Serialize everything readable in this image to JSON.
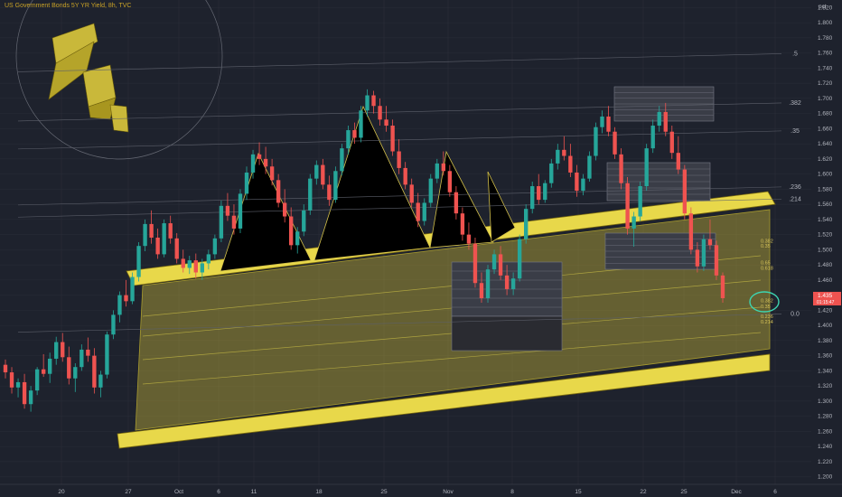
{
  "symbol": {
    "title": "US Government Bonds 5Y YR Yield, 8h, TVC"
  },
  "colors": {
    "background": "#1e222d",
    "grid": "#2a2e39",
    "up": "#26a69a",
    "down": "#ef5350",
    "gold": "#c9b83a",
    "gold_light": "#e8d84a",
    "gold_dark": "#8a7a10",
    "last_price_bg": "#ef5350",
    "circle": "#3dd4b0"
  },
  "chart_data": {
    "type": "candlestick",
    "y_unit_label": "pct",
    "ylim": [
      1.19,
      1.83
    ],
    "y_ticks": [
      "1.200",
      "1.220",
      "1.240",
      "1.260",
      "1.280",
      "1.300",
      "1.320",
      "1.340",
      "1.360",
      "1.380",
      "1.400",
      "1.420",
      "1.440",
      "1.460",
      "1.480",
      "1.500",
      "1.520",
      "1.540",
      "1.560",
      "1.580",
      "1.600",
      "1.620",
      "1.640",
      "1.660",
      "1.680",
      "1.700",
      "1.720",
      "1.740",
      "1.760",
      "1.780",
      "1.800",
      "1.820"
    ],
    "x_ticks": [
      "20",
      "27",
      "Oct",
      "6",
      "11",
      "18",
      "25",
      "Nov",
      "8",
      "15",
      "22",
      "25",
      "Dec",
      "6"
    ],
    "fib_levels": [
      {
        "label": ".5",
        "value": 1.759
      },
      {
        "label": ".382",
        "value": 1.694
      },
      {
        "label": ".35",
        "value": 1.657
      },
      {
        "label": ".236",
        "value": 1.583
      },
      {
        "label": ".214",
        "value": 1.567
      },
      {
        "label": "0.0",
        "value": 1.415
      }
    ],
    "small_labels": [
      {
        "label": "0.382",
        "value": 1.512
      },
      {
        "label": "0.35",
        "value": 1.505
      },
      {
        "label": "0.65",
        "value": 1.483
      },
      {
        "label": "0.618",
        "value": 1.476
      },
      {
        "label": "0.382",
        "value": 1.433
      },
      {
        "label": "0.35",
        "value": 1.425
      },
      {
        "label": "0.236",
        "value": 1.412
      },
      {
        "label": "0.214",
        "value": 1.405
      }
    ],
    "last_price": {
      "value": 1.436,
      "label": "1.435",
      "sub": "01:15:47"
    },
    "candles": [
      [
        1.348,
        1.355,
        1.33,
        1.338
      ],
      [
        1.338,
        1.345,
        1.31,
        1.318
      ],
      [
        1.318,
        1.33,
        1.305,
        1.325
      ],
      [
        1.325,
        1.336,
        1.29,
        1.296
      ],
      [
        1.296,
        1.32,
        1.286,
        1.314
      ],
      [
        1.314,
        1.345,
        1.308,
        1.342
      ],
      [
        1.342,
        1.362,
        1.332,
        1.336
      ],
      [
        1.336,
        1.364,
        1.324,
        1.356
      ],
      [
        1.356,
        1.385,
        1.348,
        1.378
      ],
      [
        1.378,
        1.39,
        1.352,
        1.358
      ],
      [
        1.358,
        1.372,
        1.322,
        1.33
      ],
      [
        1.33,
        1.35,
        1.312,
        1.345
      ],
      [
        1.345,
        1.375,
        1.34,
        1.368
      ],
      [
        1.368,
        1.384,
        1.352,
        1.36
      ],
      [
        1.36,
        1.37,
        1.31,
        1.318
      ],
      [
        1.318,
        1.34,
        1.305,
        1.335
      ],
      [
        1.335,
        1.392,
        1.33,
        1.388
      ],
      [
        1.388,
        1.42,
        1.382,
        1.414
      ],
      [
        1.414,
        1.445,
        1.404,
        1.44
      ],
      [
        1.44,
        1.46,
        1.425,
        1.432
      ],
      [
        1.432,
        1.47,
        1.428,
        1.464
      ],
      [
        1.464,
        1.51,
        1.458,
        1.505
      ],
      [
        1.505,
        1.54,
        1.498,
        1.534
      ],
      [
        1.534,
        1.552,
        1.508,
        1.516
      ],
      [
        1.516,
        1.528,
        1.488,
        1.494
      ],
      [
        1.494,
        1.54,
        1.49,
        1.535
      ],
      [
        1.535,
        1.545,
        1.508,
        1.515
      ],
      [
        1.515,
        1.522,
        1.482,
        1.488
      ],
      [
        1.488,
        1.5,
        1.47,
        1.476
      ],
      [
        1.476,
        1.492,
        1.468,
        1.486
      ],
      [
        1.486,
        1.495,
        1.462,
        1.47
      ],
      [
        1.47,
        1.488,
        1.46,
        1.482
      ],
      [
        1.482,
        1.5,
        1.474,
        1.494
      ],
      [
        1.494,
        1.52,
        1.488,
        1.515
      ],
      [
        1.515,
        1.565,
        1.51,
        1.558
      ],
      [
        1.558,
        1.575,
        1.538,
        1.545
      ],
      [
        1.545,
        1.56,
        1.52,
        1.528
      ],
      [
        1.528,
        1.58,
        1.522,
        1.574
      ],
      [
        1.574,
        1.61,
        1.566,
        1.602
      ],
      [
        1.602,
        1.632,
        1.594,
        1.626
      ],
      [
        1.626,
        1.642,
        1.612,
        1.62
      ],
      [
        1.62,
        1.636,
        1.6,
        1.61
      ],
      [
        1.61,
        1.62,
        1.585,
        1.592
      ],
      [
        1.592,
        1.6,
        1.556,
        1.562
      ],
      [
        1.562,
        1.58,
        1.536,
        1.544
      ],
      [
        1.544,
        1.556,
        1.5,
        1.506
      ],
      [
        1.506,
        1.53,
        1.495,
        1.524
      ],
      [
        1.524,
        1.56,
        1.518,
        1.552
      ],
      [
        1.552,
        1.6,
        1.546,
        1.594
      ],
      [
        1.594,
        1.618,
        1.586,
        1.612
      ],
      [
        1.612,
        1.62,
        1.58,
        1.586
      ],
      [
        1.586,
        1.598,
        1.558,
        1.566
      ],
      [
        1.566,
        1.61,
        1.562,
        1.604
      ],
      [
        1.604,
        1.64,
        1.598,
        1.634
      ],
      [
        1.634,
        1.664,
        1.626,
        1.658
      ],
      [
        1.658,
        1.668,
        1.64,
        1.648
      ],
      [
        1.648,
        1.69,
        1.642,
        1.684
      ],
      [
        1.684,
        1.712,
        1.676,
        1.704
      ],
      [
        1.704,
        1.71,
        1.68,
        1.69
      ],
      [
        1.69,
        1.7,
        1.664,
        1.672
      ],
      [
        1.672,
        1.69,
        1.656,
        1.664
      ],
      [
        1.664,
        1.672,
        1.624,
        1.63
      ],
      [
        1.63,
        1.646,
        1.6,
        1.608
      ],
      [
        1.608,
        1.616,
        1.58,
        1.586
      ],
      [
        1.586,
        1.594,
        1.556,
        1.562
      ],
      [
        1.562,
        1.575,
        1.53,
        1.538
      ],
      [
        1.538,
        1.568,
        1.532,
        1.562
      ],
      [
        1.562,
        1.6,
        1.556,
        1.594
      ],
      [
        1.594,
        1.62,
        1.588,
        1.614
      ],
      [
        1.614,
        1.63,
        1.598,
        1.604
      ],
      [
        1.604,
        1.612,
        1.57,
        1.576
      ],
      [
        1.576,
        1.584,
        1.54,
        1.548
      ],
      [
        1.548,
        1.556,
        1.512,
        1.52
      ],
      [
        1.52,
        1.536,
        1.5,
        1.508
      ],
      [
        1.508,
        1.516,
        1.45,
        1.456
      ],
      [
        1.456,
        1.47,
        1.43,
        1.436
      ],
      [
        1.436,
        1.48,
        1.43,
        1.474
      ],
      [
        1.474,
        1.5,
        1.468,
        1.494
      ],
      [
        1.494,
        1.505,
        1.46,
        1.466
      ],
      [
        1.466,
        1.48,
        1.44,
        1.448
      ],
      [
        1.448,
        1.47,
        1.44,
        1.462
      ],
      [
        1.462,
        1.52,
        1.458,
        1.514
      ],
      [
        1.514,
        1.56,
        1.508,
        1.554
      ],
      [
        1.554,
        1.59,
        1.548,
        1.584
      ],
      [
        1.584,
        1.6,
        1.56,
        1.566
      ],
      [
        1.566,
        1.592,
        1.562,
        1.588
      ],
      [
        1.588,
        1.62,
        1.582,
        1.614
      ],
      [
        1.614,
        1.64,
        1.606,
        1.632
      ],
      [
        1.632,
        1.65,
        1.618,
        1.624
      ],
      [
        1.624,
        1.64,
        1.596,
        1.602
      ],
      [
        1.602,
        1.612,
        1.57,
        1.578
      ],
      [
        1.578,
        1.6,
        1.572,
        1.594
      ],
      [
        1.594,
        1.63,
        1.59,
        1.624
      ],
      [
        1.624,
        1.668,
        1.618,
        1.662
      ],
      [
        1.662,
        1.684,
        1.654,
        1.676
      ],
      [
        1.676,
        1.69,
        1.65,
        1.656
      ],
      [
        1.656,
        1.662,
        1.62,
        1.626
      ],
      [
        1.626,
        1.634,
        1.58,
        1.588
      ],
      [
        1.588,
        1.596,
        1.52,
        1.528
      ],
      [
        1.528,
        1.55,
        1.504,
        1.544
      ],
      [
        1.544,
        1.59,
        1.538,
        1.584
      ],
      [
        1.584,
        1.64,
        1.578,
        1.634
      ],
      [
        1.634,
        1.672,
        1.628,
        1.664
      ],
      [
        1.664,
        1.69,
        1.656,
        1.682
      ],
      [
        1.682,
        1.694,
        1.65,
        1.656
      ],
      [
        1.656,
        1.664,
        1.62,
        1.628
      ],
      [
        1.628,
        1.65,
        1.6,
        1.606
      ],
      [
        1.606,
        1.612,
        1.54,
        1.548
      ],
      [
        1.548,
        1.556,
        1.494,
        1.5
      ],
      [
        1.5,
        1.51,
        1.47,
        1.478
      ],
      [
        1.478,
        1.52,
        1.472,
        1.514
      ],
      [
        1.514,
        1.54,
        1.5,
        1.506
      ],
      [
        1.506,
        1.512,
        1.46,
        1.466
      ],
      [
        1.466,
        1.47,
        1.43,
        1.436
      ]
    ]
  }
}
